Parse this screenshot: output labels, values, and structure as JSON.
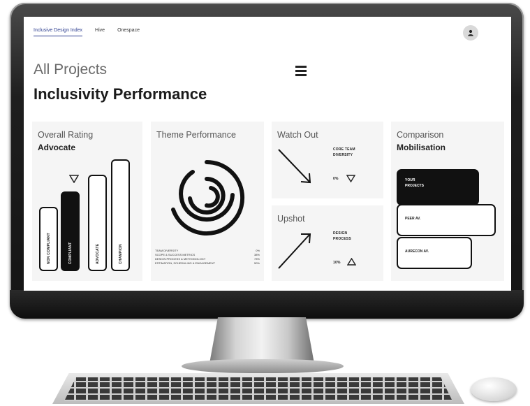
{
  "nav": {
    "links": [
      "Inclusive Design Index",
      "Hive",
      "Onespace"
    ],
    "active_index": 0
  },
  "header": {
    "title": "All Projects",
    "subtitle": "Inclusivity Performance",
    "menu_icon": "hamburger-menu-icon",
    "avatar_icon": "user-icon"
  },
  "overall_rating": {
    "title": "Overall Rating",
    "value": "Advocate",
    "marker_icon": "triangle-down-icon",
    "levels": [
      "NON COMPLIANT",
      "COMPLIANT",
      "ADVOCATE",
      "CHAMPION"
    ],
    "current_level": "COMPLIANT"
  },
  "theme_performance": {
    "title": "Theme Performance",
    "ring_icon": "concentric-arcs-icon",
    "items": [
      {
        "label": "TEAM DIVERSITY",
        "value": "0%"
      },
      {
        "label": "SCOPE & SUCCESS METRICS",
        "value": "38%"
      },
      {
        "label": "DESIGN PROCESS & METHODOLOGY",
        "value": "73%"
      },
      {
        "label": "ESTIMATION, SCHEDULING & ENGAGEMENT",
        "value": "50%"
      }
    ]
  },
  "watch_out": {
    "title": "Watch Out",
    "line1": "CORE TEAM",
    "line2": "DIVERSITY",
    "value": "0%",
    "trend_icon": "triangle-down-icon",
    "arrow_icon": "arrow-down-right-icon"
  },
  "upshot": {
    "title": "Upshot",
    "line1": "DESIGN",
    "line2": "PROCESS",
    "value": "10%",
    "trend_icon": "triangle-up-icon",
    "arrow_icon": "arrow-up-right-icon"
  },
  "comparison": {
    "title": "Comparison",
    "value": "Mobilisation",
    "items": [
      {
        "line1": "YOUR",
        "line2": "PROJECTS"
      },
      {
        "line1": "PEER AV.",
        "line2": ""
      },
      {
        "line1": "AURECON AV.",
        "line2": ""
      }
    ]
  },
  "colors": {
    "accent": "#2c3d8f",
    "ink": "#111111",
    "card": "#f5f5f5"
  }
}
